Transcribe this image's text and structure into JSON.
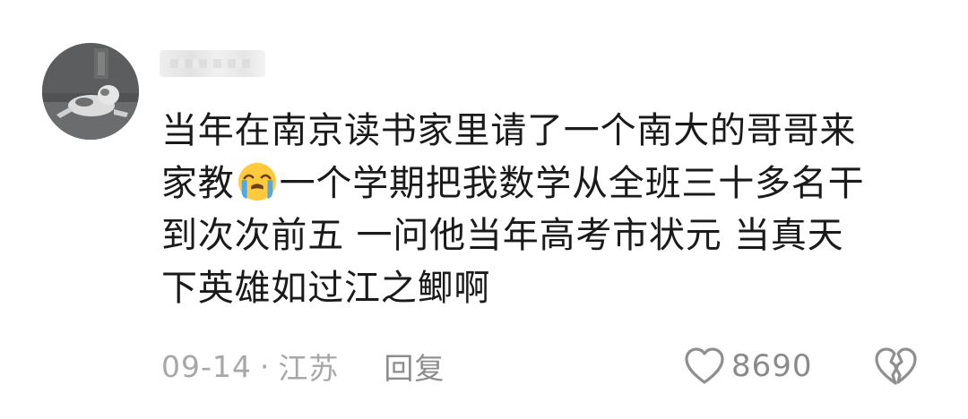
{
  "comment": {
    "avatar_icon": "cat-lying-on-sofa-avatar",
    "username_icon": "blurred-username",
    "lines": [
      "当年在南京读书家里请了一个南大的哥哥来",
      "家教",
      "一个学期把我数学从全班三十多名干",
      "到次次前五 一问他当年高考市状元 当真天",
      "下英雄如过江之鲫啊"
    ],
    "emoji_icon": "loudly-crying-face-emoji",
    "date": "09-14",
    "separator": "·",
    "location": "江苏",
    "reply_label": "回复",
    "like_icon": "heart-outline-icon",
    "like_count": "8690",
    "dislike_icon": "broken-heart-icon"
  }
}
